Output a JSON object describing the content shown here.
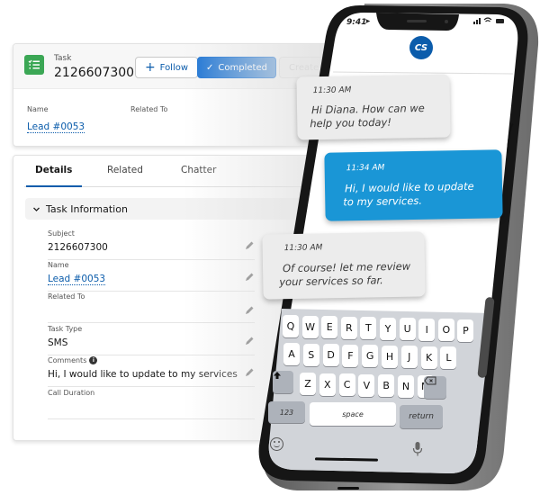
{
  "record_header": {
    "object_type": "Task",
    "record_name": "2126607300",
    "buttons": {
      "follow": "Follow",
      "completed": "Completed",
      "create": "Create"
    },
    "fields": [
      {
        "label": "Name",
        "value": "Lead #0053"
      },
      {
        "label": "Related To",
        "value": ""
      }
    ]
  },
  "details_card": {
    "tabs": [
      {
        "label": "Details",
        "active": true
      },
      {
        "label": "Related",
        "active": false
      },
      {
        "label": "Chatter",
        "active": false
      }
    ],
    "section_title": "Task Information",
    "fields": [
      {
        "label": "Subject",
        "value": "2126607300",
        "link": false
      },
      {
        "label": "Name",
        "value": "Lead #0053",
        "link": true
      },
      {
        "label": "Related To",
        "value": "",
        "link": false
      },
      {
        "label": "Task Type",
        "value": "SMS",
        "link": false
      },
      {
        "label": "Comments",
        "value": "Hi, I would like to update to my services",
        "link": false,
        "info": "i"
      },
      {
        "label": "Call Duration",
        "value": "",
        "link": false
      }
    ]
  },
  "phone": {
    "status_time": "9:41",
    "contact_initials": "CS",
    "messages": [
      {
        "direction": "incoming",
        "time": "11:30 AM",
        "line1": "Hi Diana. How can we",
        "line2": "help you today!"
      },
      {
        "direction": "outgoing",
        "time": "11:34 AM",
        "line1": "Hi, I would like to update",
        "line2": "to my services."
      },
      {
        "direction": "incoming",
        "time": "11:30 AM",
        "line1": "Of course! let me review",
        "line2": "your services so far."
      }
    ],
    "keyboard": {
      "row1": [
        "Q",
        "W",
        "E",
        "R",
        "T",
        "Y",
        "U",
        "I",
        "O",
        "P"
      ],
      "row2": [
        "A",
        "S",
        "D",
        "F",
        "G",
        "H",
        "J",
        "K",
        "L"
      ],
      "row3": [
        "Z",
        "X",
        "C",
        "V",
        "B",
        "N",
        "M"
      ],
      "numbers_key": "123",
      "space_key": "space",
      "return_key": "return"
    }
  },
  "colors": {
    "brand_blue": "#0b5cab",
    "completed_blue": "#1b73d4",
    "task_green": "#3ba755",
    "outgoing_bubble": "#1a96d6",
    "incoming_bubble": "#ececec"
  }
}
